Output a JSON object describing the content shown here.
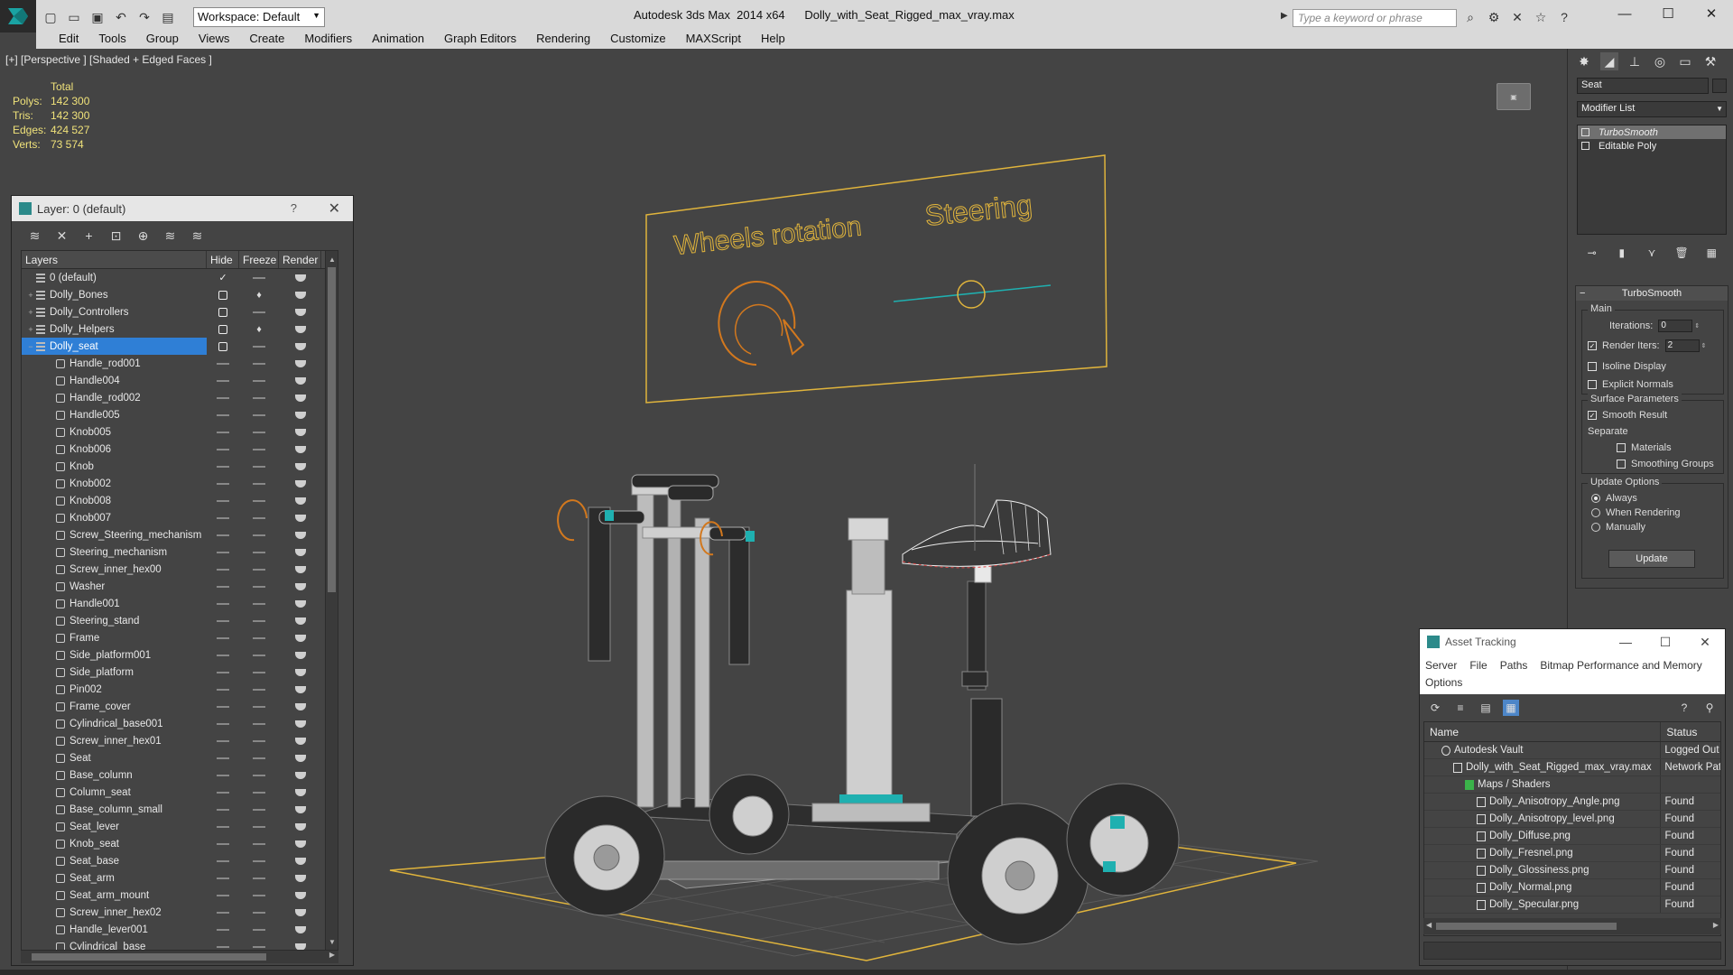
{
  "titlebar": {
    "app_title": "Autodesk 3ds Max  2014 x64",
    "file_name": "Dolly_with_Seat_Rigged_max_vray.max",
    "workspace": "Workspace: Default",
    "search_placeholder": "Type a keyword or phrase"
  },
  "menu": [
    "Edit",
    "Tools",
    "Group",
    "Views",
    "Create",
    "Modifiers",
    "Animation",
    "Graph Editors",
    "Rendering",
    "Customize",
    "MAXScript",
    "Help"
  ],
  "viewport": {
    "label": "[+] [Perspective ] [Shaded + Edged Faces ]",
    "stats": {
      "header": "Total",
      "rows": [
        {
          "k": "Polys:",
          "v": "142 300"
        },
        {
          "k": "Tris:",
          "v": "142 300"
        },
        {
          "k": "Edges:",
          "v": "424 527"
        },
        {
          "k": "Verts:",
          "v": "73 574"
        }
      ]
    },
    "scene_text": {
      "wheels": "Wheels rotation",
      "steering": "Steering"
    },
    "colors": {
      "wire_yellow": "#e0b43c",
      "wire_orange": "#d2781e",
      "teal": "#1fb0b0",
      "accent_blue": "#2f7fd6"
    }
  },
  "layer_dialog": {
    "title": "Layer: 0 (default)",
    "help": "?",
    "columns": {
      "name": "Layers",
      "hide": "Hide",
      "freeze": "Freeze",
      "render": "Render"
    },
    "rows": [
      {
        "name": "0 (default)",
        "type": "layer",
        "expand": "",
        "hide": "check",
        "selected": false
      },
      {
        "name": "Dolly_Bones",
        "type": "layer",
        "expand": "+",
        "hide": "box",
        "bulb": true,
        "selected": false
      },
      {
        "name": "Dolly_Controllers",
        "type": "layer",
        "expand": "+",
        "hide": "box",
        "selected": false
      },
      {
        "name": "Dolly_Helpers",
        "type": "layer",
        "expand": "+",
        "hide": "box",
        "bulb": true,
        "selected": false
      },
      {
        "name": "Dolly_seat",
        "type": "layer",
        "expand": "−",
        "hide": "box",
        "selected": true
      },
      {
        "name": "Handle_rod001",
        "type": "obj"
      },
      {
        "name": "Handle004",
        "type": "obj"
      },
      {
        "name": "Handle_rod002",
        "type": "obj"
      },
      {
        "name": "Handle005",
        "type": "obj"
      },
      {
        "name": "Knob005",
        "type": "obj"
      },
      {
        "name": "Knob006",
        "type": "obj"
      },
      {
        "name": "Knob",
        "type": "obj"
      },
      {
        "name": "Knob002",
        "type": "obj"
      },
      {
        "name": "Knob008",
        "type": "obj"
      },
      {
        "name": "Knob007",
        "type": "obj"
      },
      {
        "name": "Screw_Steering_mechanism",
        "type": "obj"
      },
      {
        "name": "Steering_mechanism",
        "type": "obj"
      },
      {
        "name": "Screw_inner_hex00",
        "type": "obj"
      },
      {
        "name": "Washer",
        "type": "obj"
      },
      {
        "name": "Handle001",
        "type": "obj"
      },
      {
        "name": "Steering_stand",
        "type": "obj"
      },
      {
        "name": "Frame",
        "type": "obj"
      },
      {
        "name": "Side_platform001",
        "type": "obj"
      },
      {
        "name": "Side_platform",
        "type": "obj"
      },
      {
        "name": "Pin002",
        "type": "obj"
      },
      {
        "name": "Frame_cover",
        "type": "obj"
      },
      {
        "name": "Cylindrical_base001",
        "type": "obj"
      },
      {
        "name": "Screw_inner_hex01",
        "type": "obj"
      },
      {
        "name": "Seat",
        "type": "obj"
      },
      {
        "name": "Base_column",
        "type": "obj"
      },
      {
        "name": "Column_seat",
        "type": "obj"
      },
      {
        "name": "Base_column_small",
        "type": "obj"
      },
      {
        "name": "Seat_lever",
        "type": "obj"
      },
      {
        "name": "Knob_seat",
        "type": "obj"
      },
      {
        "name": "Seat_base",
        "type": "obj"
      },
      {
        "name": "Seat_arm",
        "type": "obj"
      },
      {
        "name": "Seat_arm_mount",
        "type": "obj"
      },
      {
        "name": "Screw_inner_hex02",
        "type": "obj"
      },
      {
        "name": "Handle_lever001",
        "type": "obj"
      },
      {
        "name": "Cylindrical_base",
        "type": "obj"
      }
    ]
  },
  "command_panel": {
    "object_name": "Seat",
    "modifier_list": "Modifier List",
    "stack": [
      {
        "label": "TurboSmooth",
        "active": true
      },
      {
        "label": "Editable Poly",
        "active": false
      }
    ],
    "turbosmooth": {
      "title": "TurboSmooth",
      "main_label": "Main",
      "iterations_label": "Iterations:",
      "iterations_value": "0",
      "render_iters_label": "Render Iters:",
      "render_iters_value": "2",
      "isoline": "Isoline Display",
      "explicit": "Explicit Normals",
      "surface_label": "Surface Parameters",
      "smooth_result": "Smooth Result",
      "separate_label": "Separate",
      "materials": "Materials",
      "smoothing_groups": "Smoothing Groups",
      "update_options_label": "Update Options",
      "always": "Always",
      "when_rendering": "When Rendering",
      "manually": "Manually",
      "update_button": "Update"
    }
  },
  "asset_dialog": {
    "title": "Asset Tracking",
    "menu": [
      "Server",
      "File",
      "Paths",
      "Bitmap Performance and Memory",
      "Options"
    ],
    "columns": {
      "name": "Name",
      "status": "Status"
    },
    "rows": [
      {
        "name": "Autodesk Vault",
        "status": "Logged Out ...",
        "indent": 1,
        "icon": "vault"
      },
      {
        "name": "Dolly_with_Seat_Rigged_max_vray.max",
        "status": "Network Path",
        "indent": 2,
        "icon": "max"
      },
      {
        "name": "Maps / Shaders",
        "status": "",
        "indent": 3,
        "icon": "maps"
      },
      {
        "name": "Dolly_Anisotropy_Angle.png",
        "status": "Found",
        "indent": 4,
        "icon": "file"
      },
      {
        "name": "Dolly_Anisotropy_level.png",
        "status": "Found",
        "indent": 4,
        "icon": "file"
      },
      {
        "name": "Dolly_Diffuse.png",
        "status": "Found",
        "indent": 4,
        "icon": "file"
      },
      {
        "name": "Dolly_Fresnel.png",
        "status": "Found",
        "indent": 4,
        "icon": "file"
      },
      {
        "name": "Dolly_Glossiness.png",
        "status": "Found",
        "indent": 4,
        "icon": "file"
      },
      {
        "name": "Dolly_Normal.png",
        "status": "Found",
        "indent": 4,
        "icon": "file"
      },
      {
        "name": "Dolly_Specular.png",
        "status": "Found",
        "indent": 4,
        "icon": "file"
      }
    ]
  }
}
